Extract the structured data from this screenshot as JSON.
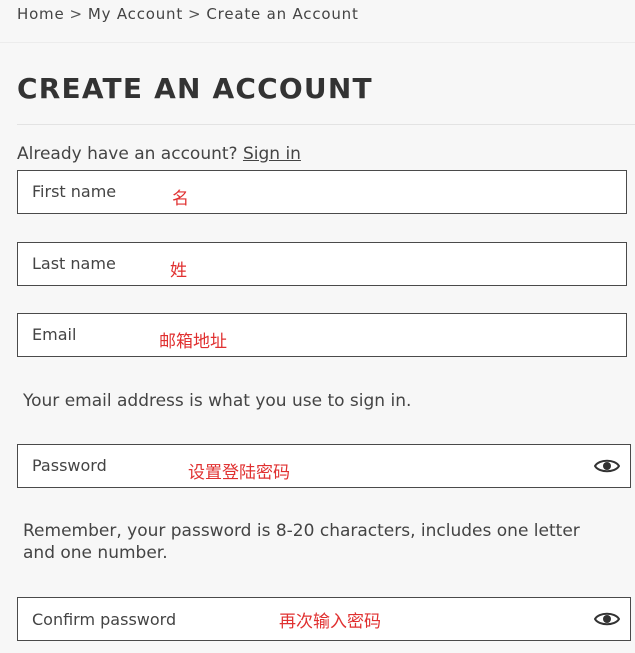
{
  "breadcrumb": {
    "items": [
      "Home",
      "My Account",
      "Create an Account"
    ],
    "separator": ">"
  },
  "page": {
    "title": "CREATE AN ACCOUNT",
    "already_text": "Already have an account?",
    "sign_in_link": "Sign in"
  },
  "form": {
    "first_name": {
      "label": "First name",
      "annotation": "名"
    },
    "last_name": {
      "label": "Last name",
      "annotation": "姓"
    },
    "email": {
      "label": "Email",
      "annotation": "邮箱地址"
    },
    "email_hint": "Your email address is what you use to sign in.",
    "password": {
      "label": "Password",
      "annotation": "设置登陆密码",
      "toggle_icon": "eye-icon"
    },
    "password_hint": "Remember, your password is 8-20 characters, includes one letter and one number.",
    "confirm_password": {
      "label": "Confirm password",
      "annotation": "再次输入密码",
      "toggle_icon": "eye-icon"
    }
  },
  "colors": {
    "annotation": "#e03030",
    "field_border": "#4a4a4a",
    "background": "#f7f7f7"
  }
}
